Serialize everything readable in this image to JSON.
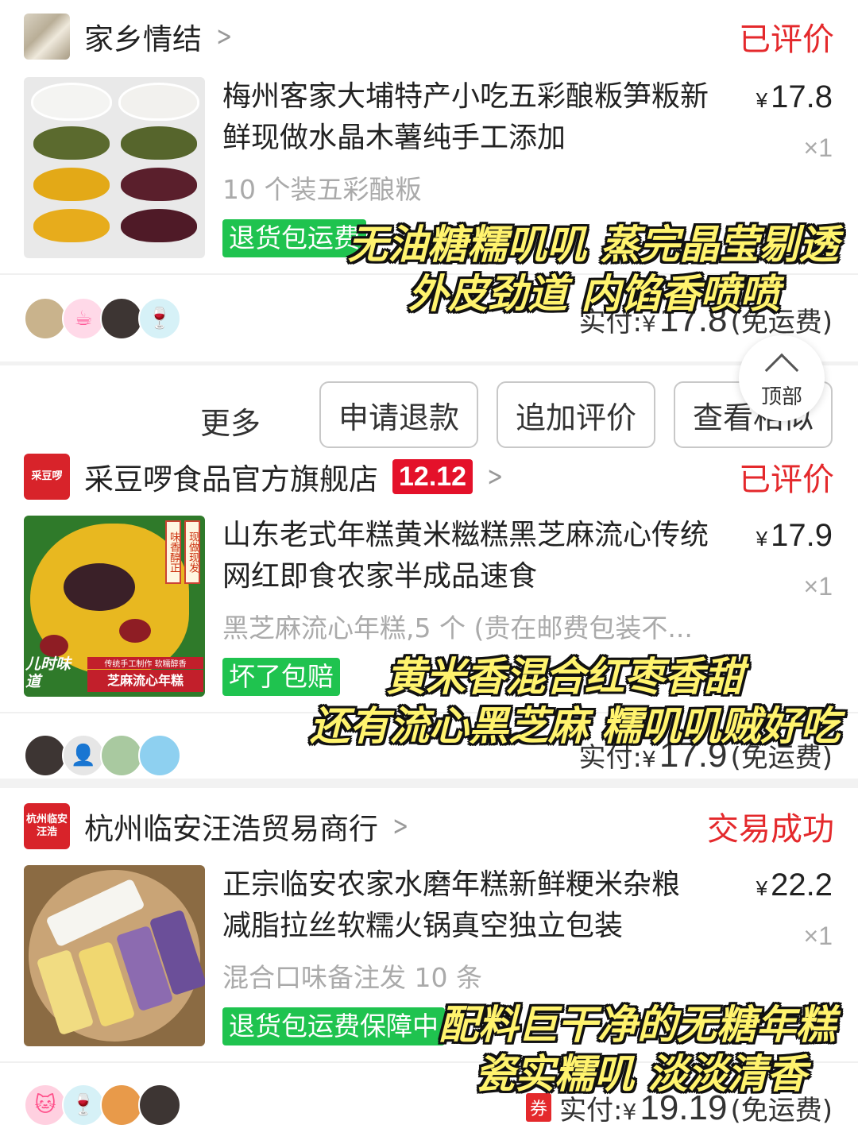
{
  "orders": [
    {
      "shop": "家乡情结",
      "status": "已评价",
      "title": "梅州客家大埔特产小吃五彩酿粄笋粄新鲜现做水晶木薯纯手工添加",
      "spec": "10 个装五彩酿粄",
      "price": "17.8",
      "qty": "×1",
      "tag": "退货包运费",
      "paid_label": "实付:",
      "paid_yen": "¥",
      "paid_amount": "17.8",
      "paid_note": "(免运费)",
      "overlay": [
        "无油糖糯叽叽  蒸完晶莹剔透",
        "外皮劲道 内馅香喷喷"
      ]
    },
    {
      "shop": "采豆啰食品官方旗舰店",
      "logo_text": "采豆啰",
      "promo": "12.12",
      "status": "已评价",
      "title": "山东老式年糕黄米糍糕黑芝麻流心传统网红即食农家半成品速食",
      "spec": "黑芝麻流心年糕,5 个 (贵在邮费包装不...",
      "price": "17.9",
      "qty": "×1",
      "tag": "坏了包赔",
      "thumb_text": [
        "现做现发",
        "味香醇正",
        "儿时味道",
        "传统手工制作 软糯醇香",
        "芝麻流心年糕"
      ],
      "paid_label": "实付:",
      "paid_yen": "¥",
      "paid_amount": "17.9",
      "paid_note": "(免运费)",
      "overlay": [
        "黄米香混合红枣香甜",
        "还有流心黑芝麻 糯叽叽贼好吃"
      ]
    },
    {
      "shop": "杭州临安汪浩贸易商行",
      "logo_text": "杭州临安汪浩",
      "status": "交易成功",
      "title": "正宗临安农家水磨年糕新鲜粳米杂粮减脂拉丝软糯火锅真空独立包装",
      "spec": "混合口味备注发 10 条",
      "price": "22.2",
      "qty": "×1",
      "tag": "退货包运费保障中",
      "coupon": "券",
      "paid_label": "实付:",
      "paid_yen": "¥",
      "paid_amount": "19.19",
      "paid_note": "(免运费)",
      "overlay": [
        "配料巨干净的无糖年糕",
        "瓷实糯叽 淡淡清香"
      ]
    }
  ],
  "actions": {
    "more": "更多",
    "refund": "申请退款",
    "add_review": "追加评价",
    "view_similar": "查看相似"
  },
  "top_button": "顶部",
  "price_yen": "¥",
  "colors": {
    "status_red": "#e4292c",
    "tag_green": "#1fc34f",
    "overlay_yellow": "#fff36e",
    "promo_red": "#e4112a"
  }
}
